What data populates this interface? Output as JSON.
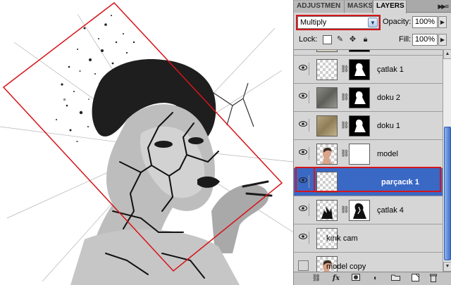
{
  "tabs": [
    {
      "label": "ADJUSTMEN",
      "active": false
    },
    {
      "label": "MASKS",
      "active": false
    },
    {
      "label": "LAYERS",
      "active": true
    }
  ],
  "blend_mode": "Multiply",
  "opacity_label": "Opacity:",
  "opacity_value": "100%",
  "lock_label": "Lock:",
  "fill_label": "Fill:",
  "fill_value": "100%",
  "lock_icons": [
    "transparency-lock-icon",
    "brush-lock-icon",
    "move-lock-icon",
    "padlock-icon"
  ],
  "layers": [
    {
      "name": "",
      "visible": true,
      "thumb": "texture-light",
      "mask": "mask-figure",
      "selected": false,
      "partial": true
    },
    {
      "name": "çatlak 1",
      "visible": true,
      "thumb": "checker",
      "mask": "mask-figure-dark",
      "selected": false
    },
    {
      "name": "doku 2",
      "visible": true,
      "thumb": "texture-gray",
      "mask": "mask-figure",
      "selected": false
    },
    {
      "name": "doku 1",
      "visible": true,
      "thumb": "texture-tan",
      "mask": "mask-figure",
      "selected": false
    },
    {
      "name": "model",
      "visible": true,
      "thumb": "portrait",
      "mask": "mask-white",
      "selected": false
    },
    {
      "name": "parçacık 1",
      "visible": true,
      "thumb": "checker",
      "mask": null,
      "selected": true
    },
    {
      "name": "çatlak 4",
      "visible": true,
      "thumb": "checker-dark",
      "mask": "mask-figure-dark",
      "selected": false
    },
    {
      "name": "kırık cam",
      "visible": true,
      "thumb": "checker",
      "mask": null,
      "selected": false
    },
    {
      "name": "model copy",
      "visible": false,
      "thumb": "portrait",
      "mask": null,
      "selected": false
    }
  ],
  "bottom_icons": [
    "link-layers-icon",
    "fx-icon",
    "add-mask-icon",
    "adjustment-layer-icon",
    "new-group-icon",
    "new-layer-icon",
    "trash-icon"
  ],
  "fx_label": "fx",
  "accent_colors": {
    "selection": "#3a68c5",
    "highlight_box": "#d6151b"
  }
}
